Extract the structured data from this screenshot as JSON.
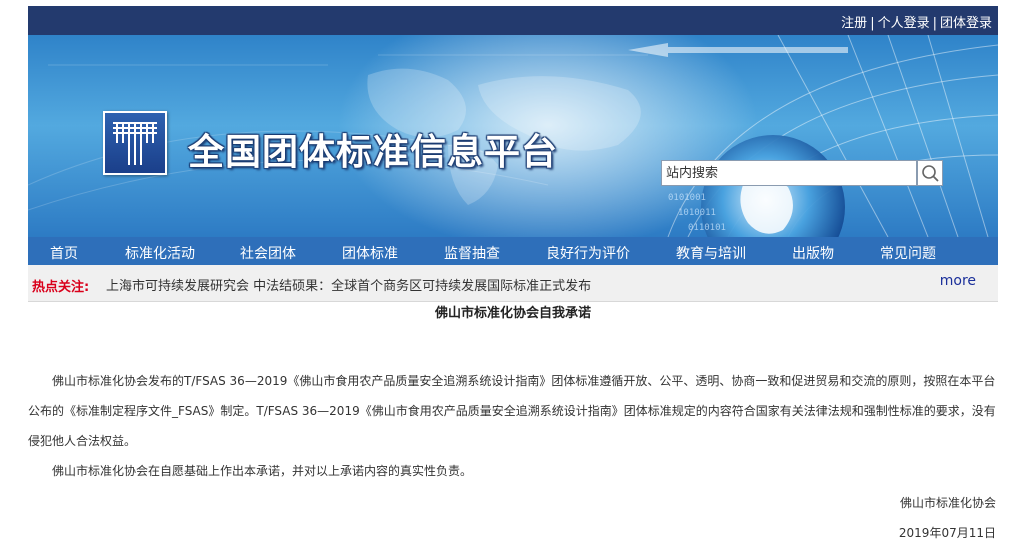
{
  "header": {
    "register": "注册",
    "separator": "|",
    "personal_login": "个人登录",
    "group_login": "团体登录"
  },
  "banner": {
    "site_title": "全国团体标准信息平台",
    "search_placeholder": "站内搜索",
    "logo_icon": "platform-logo-icon",
    "search_icon": "search-icon"
  },
  "nav": {
    "items": [
      "首页",
      "标准化活动",
      "社会团体",
      "团体标准",
      "监督抽查",
      "良好行为评价",
      "教育与培训",
      "出版物",
      "常见问题"
    ]
  },
  "hot_news": {
    "label": "热点关注:",
    "headline": "上海市可持续发展研究会 中法结硕果：全球首个商务区可持续发展国际标准正式发布",
    "more": "more"
  },
  "article": {
    "title": "佛山市标准化协会自我承诺",
    "paragraph1": "佛山市标准化协会发布的T/FSAS 36—2019《佛山市食用农产品质量安全追溯系统设计指南》团体标准遵循开放、公平、透明、协商一致和促进贸易和交流的原则，按照在本平台公布的《标准制定程序文件_FSAS》制定。T/FSAS 36—2019《佛山市食用农产品质量安全追溯系统设计指南》团体标准规定的内容符合国家有关法律法规和强制性标准的要求，没有侵犯他人合法权益。",
    "paragraph2": "佛山市标准化协会在自愿基础上作出本承诺，并对以上承诺内容的真实性负责。",
    "signature": "佛山市标准化协会",
    "date": "2019年07月11日"
  },
  "colors": {
    "topbar": "#233a6e",
    "nav": "#2e6fba",
    "hot_label": "#d9001b",
    "more_link": "#1a2f9a"
  }
}
